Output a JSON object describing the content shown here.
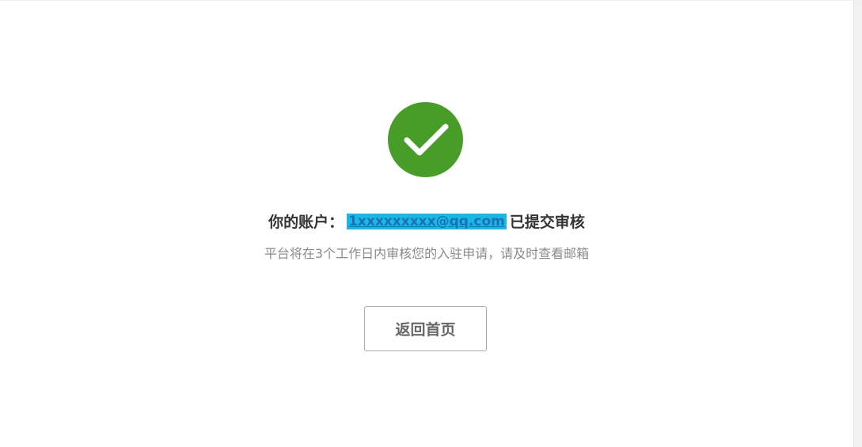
{
  "status": {
    "icon": "check-circle-icon",
    "icon_color": "#479d27",
    "headline_prefix": "你的账户：",
    "account_email": "1xxxxxxxxx@qq.com",
    "headline_suffix": "已提交审核",
    "subtext": "平台将在3个工作日内审核您的入驻申请，请及时查看邮箱"
  },
  "actions": {
    "home_label": "返回首页"
  }
}
